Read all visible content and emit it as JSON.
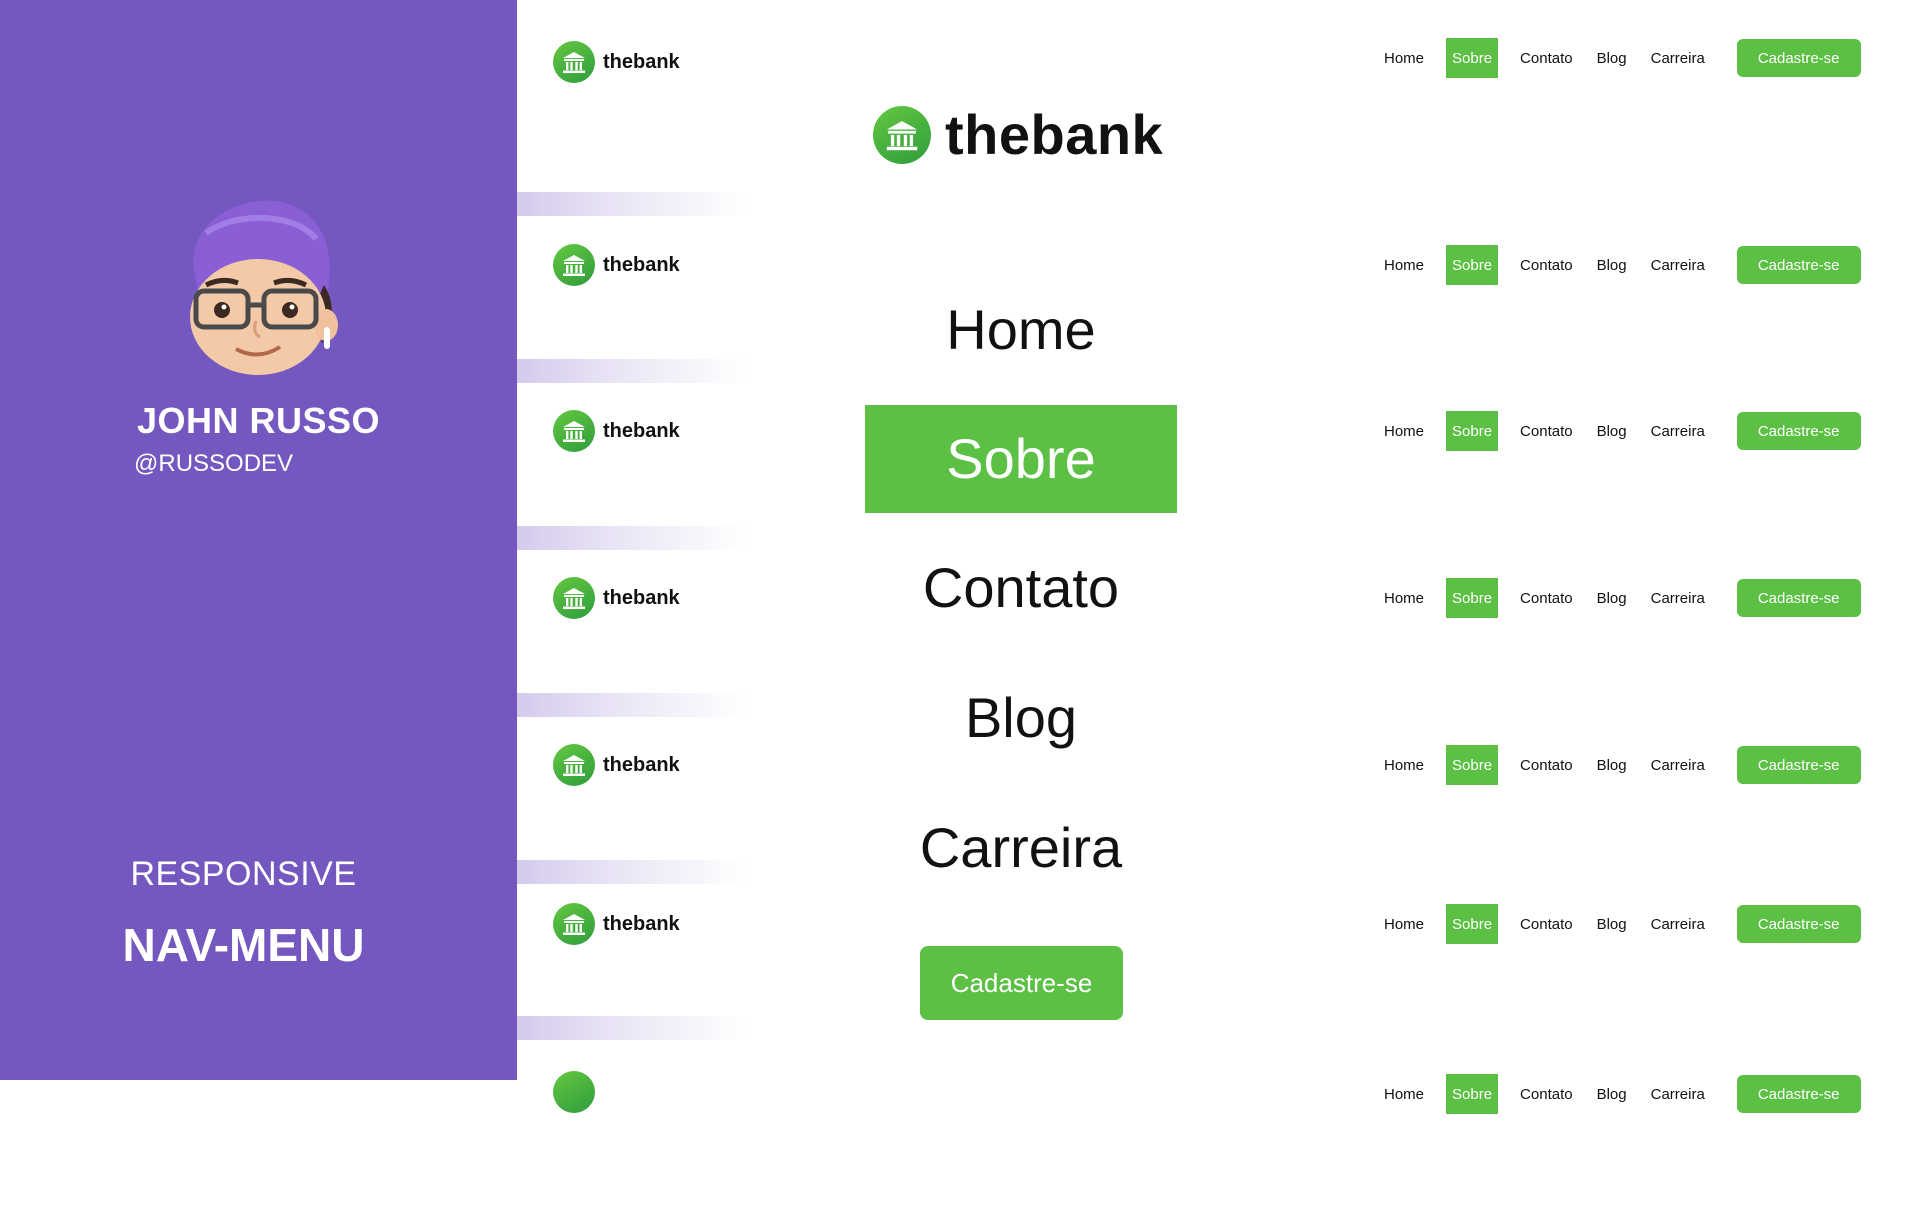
{
  "author": {
    "name": "JOHN RUSSO",
    "handle": "@RUSSODEV"
  },
  "tagline": {
    "line1": "RESPONSIVE",
    "line2": "NAV-MENU"
  },
  "brand": {
    "name": "thebank",
    "icon": "bank-icon",
    "accent_color": "#5bc043",
    "panel_color": "#7458bf"
  },
  "nav": {
    "items": [
      "Home",
      "Sobre",
      "Contato",
      "Blog",
      "Carreira"
    ],
    "active": "Sobre",
    "cta_label": "Cadastre-se"
  },
  "mobile_menu": {
    "items": [
      "Home",
      "Sobre",
      "Contato",
      "Blog",
      "Carreira"
    ],
    "active": "Sobre",
    "cta_label": "Cadastre-se"
  }
}
